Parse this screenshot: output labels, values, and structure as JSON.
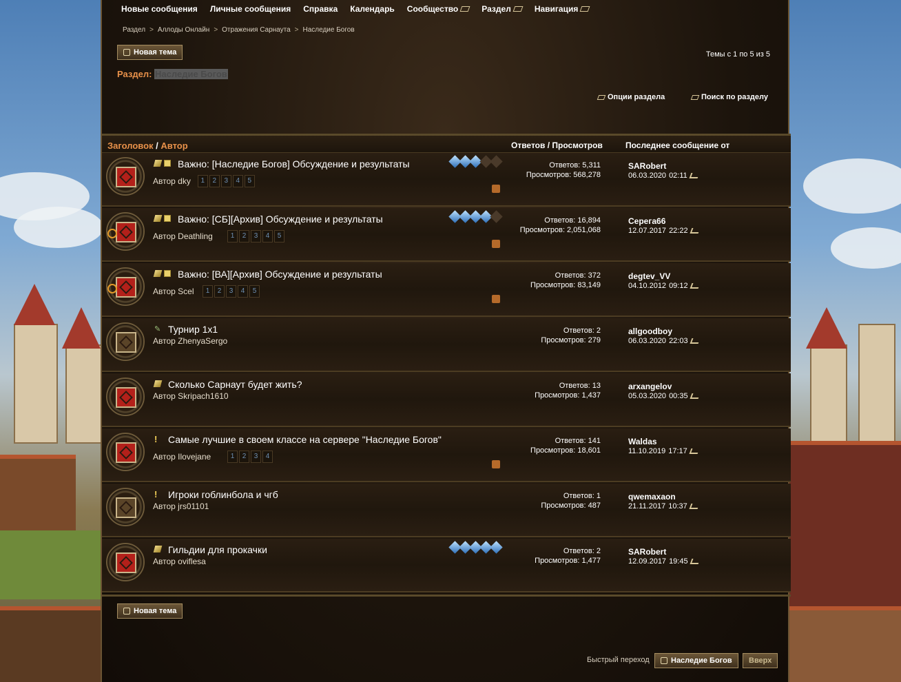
{
  "nav": {
    "items": [
      {
        "label": "Новые сообщения",
        "dropdown": false
      },
      {
        "label": "Личные сообщения",
        "dropdown": false
      },
      {
        "label": "Справка",
        "dropdown": false
      },
      {
        "label": "Календарь",
        "dropdown": false
      },
      {
        "label": "Сообщество",
        "dropdown": true
      },
      {
        "label": "Раздел",
        "dropdown": true
      },
      {
        "label": "Навигация",
        "dropdown": true
      }
    ]
  },
  "breadcrumb": {
    "items": [
      "Раздел",
      "Аллоды Онлайн",
      "Отражения Сарнаута",
      "Наследие Богов"
    ],
    "separator": ">"
  },
  "toolbar": {
    "new_topic_label": "Новая тема",
    "topics_count": "Темы с 1 по 5 из 5",
    "section_prefix": "Раздел:",
    "section_name": "Наследие Богов",
    "options_label": "Опции раздела",
    "search_label": "Поиск по разделу"
  },
  "table": {
    "head_title": "Заголовок",
    "head_slash": "/",
    "head_author": "Автор",
    "head_stats": "Ответов / Просмотров",
    "head_last": "Последнее сообщение от"
  },
  "threads": [
    {
      "status": "hot",
      "ring": false,
      "icons": [
        "pin",
        "sticky"
      ],
      "title": "Важно: [Наследие Богов] Обсуждение и результаты",
      "author": "Автор dky",
      "pages": [
        "1",
        "2",
        "3",
        "4",
        "5"
      ],
      "rating": 3,
      "attachment": true,
      "replies": "Ответов: 5,311",
      "views": "Просмотров: 568,278",
      "last_user": "SARobert",
      "last_date": "06.03.2020",
      "last_time": "02:11"
    },
    {
      "status": "hot",
      "ring": true,
      "icons": [
        "pin",
        "sticky"
      ],
      "title": "Важно: [СБ][Архив] Обсуждение и результаты",
      "author": "Автор Deathling",
      "pages": [
        "1",
        "2",
        "3",
        "4",
        "5"
      ],
      "rating": 4,
      "attachment": true,
      "replies": "Ответов: 16,894",
      "views": "Просмотров: 2,051,068",
      "last_user": "Серега66",
      "last_date": "12.07.2017",
      "last_time": "22:22"
    },
    {
      "status": "hot",
      "ring": true,
      "icons": [
        "pin",
        "sticky"
      ],
      "title": "Важно: [ВА][Архив] Обсуждение и результаты",
      "author": "Автор Scel",
      "pages": [
        "1",
        "2",
        "3",
        "4",
        "5"
      ],
      "rating": 0,
      "attachment": true,
      "replies": "Ответов: 372",
      "views": "Просмотров: 83,149",
      "last_user": "degtev_VV",
      "last_date": "04.10.2012",
      "last_time": "09:12"
    },
    {
      "status": "cold",
      "ring": false,
      "icons": [
        "tool"
      ],
      "title": "Турнир 1x1",
      "author": "Автор ZhenyaSergo",
      "pages": [],
      "rating": 0,
      "attachment": false,
      "replies": "Ответов: 2",
      "views": "Просмотров: 279",
      "last_user": "allgoodboy",
      "last_date": "06.03.2020",
      "last_time": "22:03"
    },
    {
      "status": "hot",
      "ring": false,
      "icons": [
        "pin"
      ],
      "title": "Сколько Сарнаут будет жить?",
      "author": "Автор Skripach1610",
      "pages": [],
      "rating": 0,
      "attachment": false,
      "replies": "Ответов: 13",
      "views": "Просмотров: 1,437",
      "last_user": "arxangelov",
      "last_date": "05.03.2020",
      "last_time": "00:35"
    },
    {
      "status": "hot",
      "ring": false,
      "icons": [
        "excl"
      ],
      "title": "Самые лучшие в своем классе на сервере \"Наследие Богов\"",
      "author": "Автор Ilovejane",
      "pages": [
        "1",
        "2",
        "3",
        "4"
      ],
      "rating": 0,
      "attachment": true,
      "replies": "Ответов: 141",
      "views": "Просмотров: 18,601",
      "last_user": "Waldas",
      "last_date": "11.10.2019",
      "last_time": "17:17"
    },
    {
      "status": "cold",
      "ring": false,
      "icons": [
        "excl"
      ],
      "title": "Игроки гоблинбола и чгб",
      "author": "Автор jrs01101",
      "pages": [],
      "rating": 0,
      "attachment": false,
      "replies": "Ответов: 1",
      "views": "Просмотров: 487",
      "last_user": "qwemaxaon",
      "last_date": "21.11.2017",
      "last_time": "10:37"
    },
    {
      "status": "hot",
      "ring": false,
      "icons": [
        "pin"
      ],
      "title": "Гильдии для прокачки",
      "author": "Автор oviflesa",
      "pages": [],
      "rating": 5,
      "attachment": false,
      "replies": "Ответов: 2",
      "views": "Просмотров: 1,477",
      "last_user": "SARobert",
      "last_date": "12.09.2017",
      "last_time": "19:45"
    }
  ],
  "footer": {
    "new_topic_label": "Новая тема",
    "quick_nav_label": "Быстрый переход",
    "quick_nav_target": "Наследие Богов",
    "go_button": "Вверх"
  }
}
